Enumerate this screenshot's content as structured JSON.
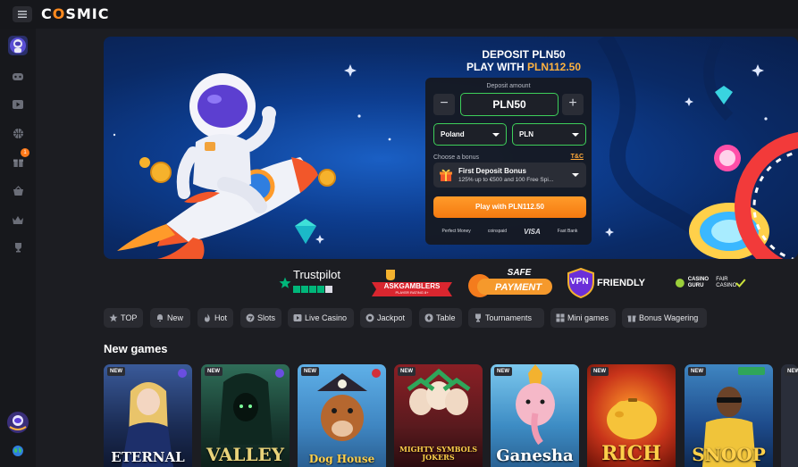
{
  "header": {
    "logo": "COSMIC",
    "logo_prefix": "C",
    "logo_o": "O",
    "logo_suffix": "SMIC"
  },
  "sidebar": {
    "items": [
      {
        "name": "avatar",
        "icon": "astronaut-avatar"
      },
      {
        "name": "sidebar-item-games",
        "icon": "gamepad-icon"
      },
      {
        "name": "sidebar-item-live",
        "icon": "play-icon"
      },
      {
        "name": "sidebar-item-sports",
        "icon": "basketball-icon"
      },
      {
        "name": "sidebar-item-bonuses",
        "icon": "gift-icon",
        "badge": "1"
      },
      {
        "name": "sidebar-item-shop",
        "icon": "basket-icon"
      },
      {
        "name": "sidebar-item-vip",
        "icon": "crown-icon"
      },
      {
        "name": "sidebar-item-tournaments",
        "icon": "trophy-icon"
      },
      {
        "name": "sidebar-item-promo",
        "icon": "promo-icon"
      },
      {
        "name": "sidebar-item-language",
        "icon": "globe-icon"
      }
    ]
  },
  "hero": {
    "line1": "DEPOSIT PLN50",
    "line2_prefix": "PLAY WITH ",
    "line2_highlight": "PLN112.50",
    "deposit_label": "Deposit amount",
    "minus": "−",
    "plus": "+",
    "amount": "PLN50",
    "country": "Poland",
    "currency": "PLN",
    "bonus_label": "Choose a bonus",
    "tc": "T&C",
    "bonus_title": "First Deposit Bonus",
    "bonus_sub": "125% up to €500 and 100 Free Spi...",
    "play_button": "Play with PLN112.50",
    "payments": [
      "Perfect Money",
      "coinspaid",
      "VISA",
      "Fast Bank"
    ]
  },
  "partners": {
    "trustpilot": "Trustpilot",
    "askgamblers": "ASKGAMBLERS",
    "askgamblers_sub": "PLAYER RATING 8+",
    "safe_top": "SAFE",
    "safe_bottom": "PAYMENT",
    "vpn_a": "VPN",
    "vpn_b": "FRIENDLY",
    "guru_a": "CASINO GURU",
    "guru_b": "FAIR CASINO"
  },
  "filters": [
    {
      "label": "TOP",
      "icon": "star-icon"
    },
    {
      "label": "New",
      "icon": "bell-icon"
    },
    {
      "label": "Hot",
      "icon": "fire-icon"
    },
    {
      "label": "Slots",
      "icon": "slots-icon"
    },
    {
      "label": "Live Casino",
      "icon": "live-icon"
    },
    {
      "label": "Jackpot",
      "icon": "jackpot-icon"
    },
    {
      "label": "Table",
      "icon": "table-icon"
    },
    {
      "label": "Tournaments",
      "icon": "trophy-icon"
    },
    {
      "label": "Mini games",
      "icon": "grid-icon"
    },
    {
      "label": "Bonus Wagering",
      "icon": "bonus-icon"
    }
  ],
  "section_title": "New games",
  "games": [
    {
      "badge": "NEW",
      "title": "ETERNAL",
      "bg": "#1e3560"
    },
    {
      "badge": "NEW",
      "title": "VALLEY",
      "bg": "#1f4a3a"
    },
    {
      "badge": "NEW",
      "title": "Dog House",
      "bg": "#3f86c2"
    },
    {
      "badge": "NEW",
      "title": "MIGHTY SYMBOLS JOKERS",
      "bg": "#5a1a1e"
    },
    {
      "badge": "NEW",
      "title": "Ganesha",
      "bg": "#2f7fb8"
    },
    {
      "badge": "NEW",
      "title": "RICH",
      "bg": "#9a2a14"
    },
    {
      "badge": "NEW",
      "title": "SNOOP",
      "bg": "#1d4a8a"
    },
    {
      "badge": "NEW",
      "title": "",
      "bg": "#2a2e3a"
    }
  ]
}
